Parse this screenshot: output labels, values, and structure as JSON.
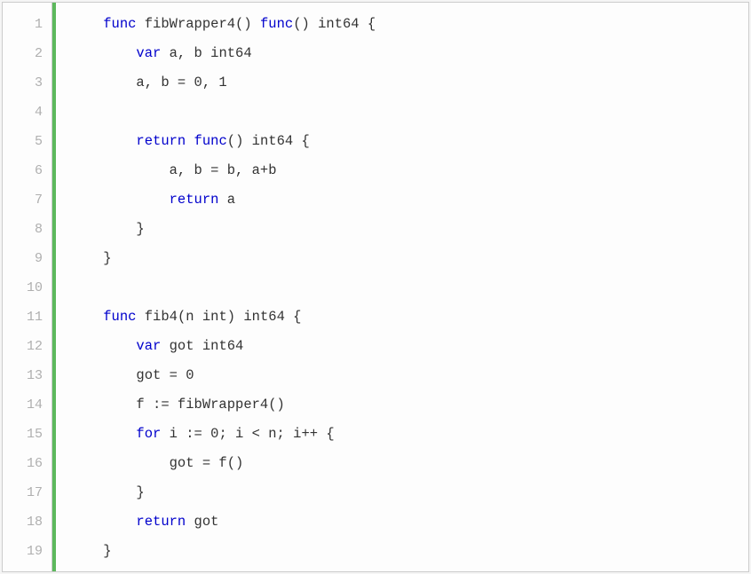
{
  "lines": [
    {
      "num": "1",
      "tokens": [
        {
          "t": "    ",
          "c": ""
        },
        {
          "t": "func",
          "c": "kw"
        },
        {
          "t": " fibWrapper4() ",
          "c": "fn"
        },
        {
          "t": "func",
          "c": "kw"
        },
        {
          "t": "() int64 {",
          "c": ""
        }
      ]
    },
    {
      "num": "2",
      "tokens": [
        {
          "t": "        ",
          "c": ""
        },
        {
          "t": "var",
          "c": "kw"
        },
        {
          "t": " a, b int64",
          "c": ""
        }
      ]
    },
    {
      "num": "3",
      "tokens": [
        {
          "t": "        a, b = 0, 1",
          "c": ""
        }
      ]
    },
    {
      "num": "4",
      "tokens": [
        {
          "t": "",
          "c": ""
        }
      ]
    },
    {
      "num": "5",
      "tokens": [
        {
          "t": "        ",
          "c": ""
        },
        {
          "t": "return",
          "c": "kw"
        },
        {
          "t": " ",
          "c": ""
        },
        {
          "t": "func",
          "c": "kw"
        },
        {
          "t": "() int64 {",
          "c": ""
        }
      ]
    },
    {
      "num": "6",
      "tokens": [
        {
          "t": "            a, b = b, a+b",
          "c": ""
        }
      ]
    },
    {
      "num": "7",
      "tokens": [
        {
          "t": "            ",
          "c": ""
        },
        {
          "t": "return",
          "c": "kw"
        },
        {
          "t": " a",
          "c": ""
        }
      ]
    },
    {
      "num": "8",
      "tokens": [
        {
          "t": "        }",
          "c": ""
        }
      ]
    },
    {
      "num": "9",
      "tokens": [
        {
          "t": "    }",
          "c": ""
        }
      ]
    },
    {
      "num": "10",
      "tokens": [
        {
          "t": "",
          "c": ""
        }
      ]
    },
    {
      "num": "11",
      "tokens": [
        {
          "t": "    ",
          "c": ""
        },
        {
          "t": "func",
          "c": "kw"
        },
        {
          "t": " fib4(n int) int64 {",
          "c": ""
        }
      ]
    },
    {
      "num": "12",
      "tokens": [
        {
          "t": "        ",
          "c": ""
        },
        {
          "t": "var",
          "c": "kw"
        },
        {
          "t": " got int64",
          "c": ""
        }
      ]
    },
    {
      "num": "13",
      "tokens": [
        {
          "t": "        got = 0",
          "c": ""
        }
      ]
    },
    {
      "num": "14",
      "tokens": [
        {
          "t": "        f := fibWrapper4()",
          "c": ""
        }
      ]
    },
    {
      "num": "15",
      "tokens": [
        {
          "t": "        ",
          "c": ""
        },
        {
          "t": "for",
          "c": "kw"
        },
        {
          "t": " i := 0; i < n; i++ {",
          "c": ""
        }
      ]
    },
    {
      "num": "16",
      "tokens": [
        {
          "t": "            got = f()",
          "c": ""
        }
      ]
    },
    {
      "num": "17",
      "tokens": [
        {
          "t": "        }",
          "c": ""
        }
      ]
    },
    {
      "num": "18",
      "tokens": [
        {
          "t": "        ",
          "c": ""
        },
        {
          "t": "return",
          "c": "kw"
        },
        {
          "t": " got",
          "c": ""
        }
      ]
    },
    {
      "num": "19",
      "tokens": [
        {
          "t": "    }",
          "c": ""
        }
      ]
    }
  ]
}
